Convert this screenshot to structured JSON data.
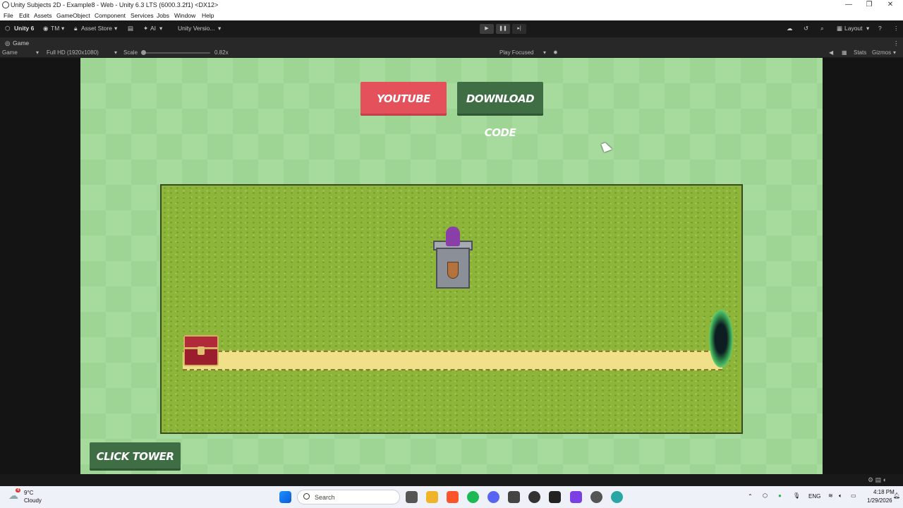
{
  "window": {
    "title": "Unity Subjects 2D - Example8 - Web - Unity 6.3 LTS (6000.3.2f1) <DX12>",
    "controls": {
      "minimize": "—",
      "maximize": "❐",
      "close": "✕"
    }
  },
  "menu": [
    "File",
    "Edit",
    "Assets",
    "GameObject",
    "Component",
    "Services",
    "Jobs",
    "Window",
    "Help"
  ],
  "toolbar": {
    "unity_label": "Unity 6",
    "account": "TM",
    "asset_store": "Asset Store",
    "ai": "AI",
    "version_control": "Unity Versio...",
    "layout": "Layout"
  },
  "game_view": {
    "tab_label": "Game",
    "display_select": "Game",
    "resolution": "Full HD (1920x1080)",
    "scale_label": "Scale",
    "scale_value": "0.82x",
    "play_mode": "Play Focused",
    "stats": "Stats",
    "gizmos": "Gizmos"
  },
  "game": {
    "youtube_button": "YOUTUBE",
    "download_button": "DOWNLOAD CODE",
    "click_tower_button": "CLICK TOWER"
  },
  "taskbar": {
    "weather_temp": "9°C",
    "weather_desc": "Cloudy",
    "weather_badge": "4",
    "search_placeholder": "Search",
    "language": "ENG",
    "time": "4:18 PM",
    "date": "1/29/2026"
  },
  "colors": {
    "youtube_red": "#e4515b",
    "button_green": "#3f6e45",
    "background_green": "#9ed595",
    "grass": "#8cb53a",
    "path_sand": "#efe089"
  }
}
